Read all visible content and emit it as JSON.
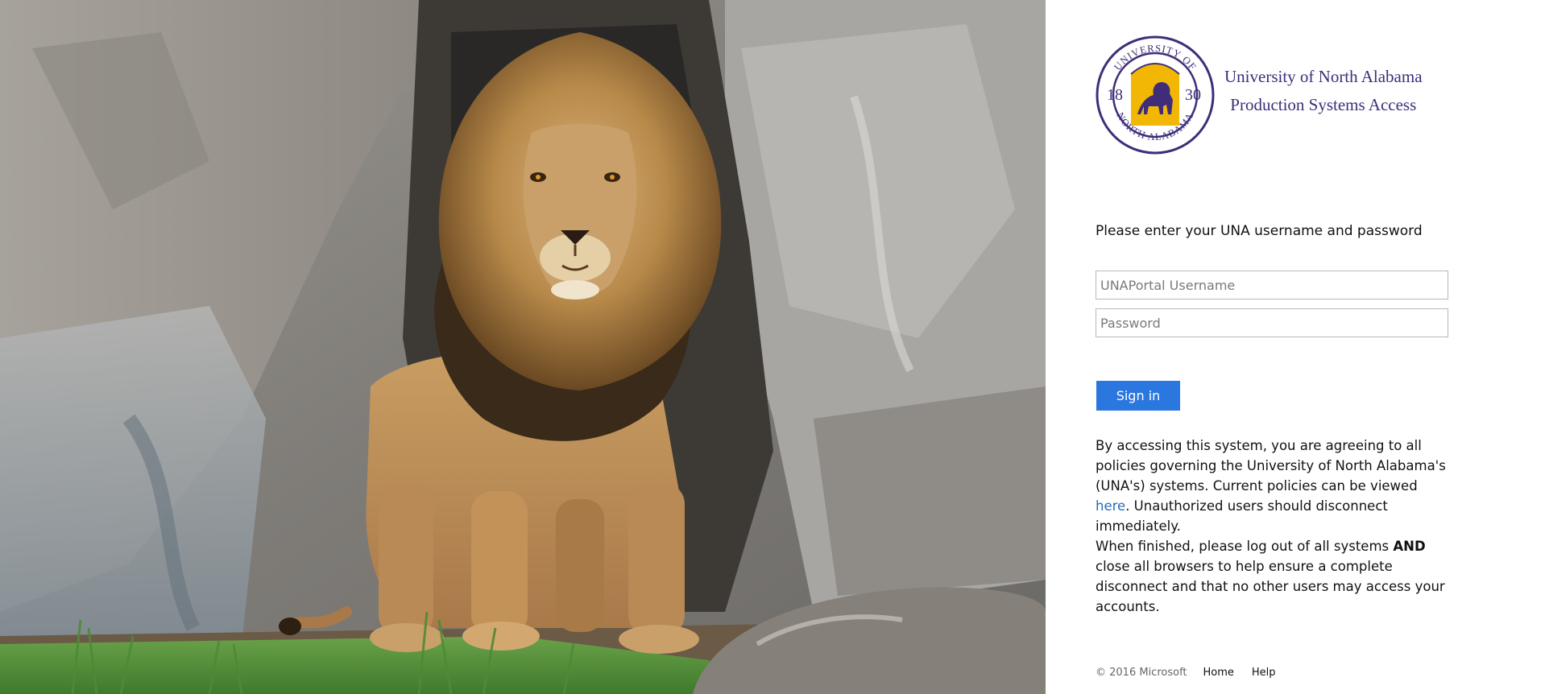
{
  "hero": {
    "alt": "lion-photo"
  },
  "brand": {
    "seal_top": "UNIVERSITY OF",
    "seal_bottom": "NORTH ALABAMA",
    "seal_year_left": "18",
    "seal_year_right": "30",
    "title_line1": "University of North Alabama",
    "title_line2": "Production Systems Access",
    "colors": {
      "purple": "#3f2d7a",
      "gold": "#f2b705"
    }
  },
  "form": {
    "intro": "Please enter your UNA username and password",
    "username_placeholder": "UNAPortal Username",
    "username_value": "",
    "password_placeholder": "Password",
    "password_value": "",
    "signin_label": "Sign in",
    "signin_color": "#2b77e0"
  },
  "notice": {
    "p1_before_link": "By accessing this system, you are agreeing to all policies governing the University of North Alabama's (UNA's) systems. Current policies can be viewed ",
    "p1_link": "here",
    "p1_after_link": ". Unauthorized users should disconnect immediately.",
    "p2_before_bold": "When finished, please log out of all systems ",
    "p2_bold": "AND",
    "p2_after_bold": " close all browsers to help ensure a complete disconnect and that no other users may access your accounts."
  },
  "footer": {
    "copyright": "© 2016 Microsoft",
    "home": "Home",
    "help": "Help"
  }
}
